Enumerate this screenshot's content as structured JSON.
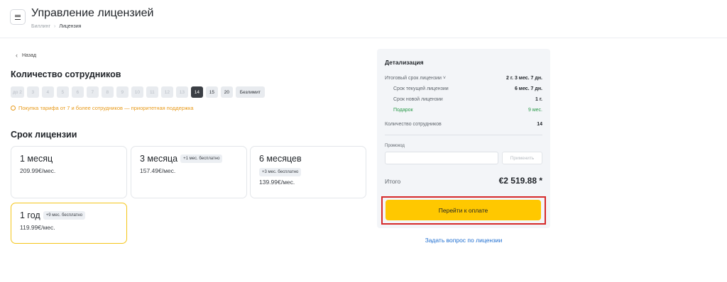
{
  "header": {
    "title": "Управление лицензией",
    "breadcrumbs": [
      "Биллинг",
      "Лицензия"
    ]
  },
  "back_label": "Назад",
  "employees": {
    "heading": "Количество сотрудников",
    "options": [
      "до 2",
      "3",
      "4",
      "5",
      "6",
      "7",
      "8",
      "9",
      "10",
      "11",
      "12",
      "13",
      "14",
      "15",
      "20",
      "Безлимит"
    ],
    "selected": "14",
    "promo_text": "Покупка тарифа от 7 и более сотрудников — приоритетная поддержка"
  },
  "term": {
    "heading": "Срок лицензии",
    "plans": [
      {
        "name": "1 месяц",
        "price": "209.99€/мес.",
        "badge": ""
      },
      {
        "name": "3 месяца",
        "price": "157.49€/мес.",
        "badge": "+1 мес. бесплатно"
      },
      {
        "name": "6 месяцев",
        "price": "139.99€/мес.",
        "badge": "+3 мес. бесплатно"
      },
      {
        "name": "1 год",
        "price": "119.99€/мес.",
        "badge": "+9 мес. бесплатно"
      }
    ],
    "selected": "1 год"
  },
  "details": {
    "title": "Детализация",
    "total_term_label": "Итоговый срок лицензии",
    "total_term_value": "2 г. 3 мес. 7 дн.",
    "current_label": "Срок текущей лицензии",
    "current_value": "6 мес. 7 дн.",
    "new_label": "Срок новой лицензии",
    "new_value": "1 г.",
    "gift_label": "Подарок",
    "gift_value": "9 мес.",
    "employees_label": "Количество сотрудников",
    "employees_value": "14",
    "promo_label": "Промокод",
    "promo_value": "",
    "apply_label": "Применить",
    "total_label": "Итого",
    "total_value": "€2 519.88 *",
    "pay_label": "Перейти к оплате",
    "highlight_color": "#d62a2a",
    "accent_color": "#ffc800"
  },
  "ask_link": "Задать вопрос по лицензии"
}
